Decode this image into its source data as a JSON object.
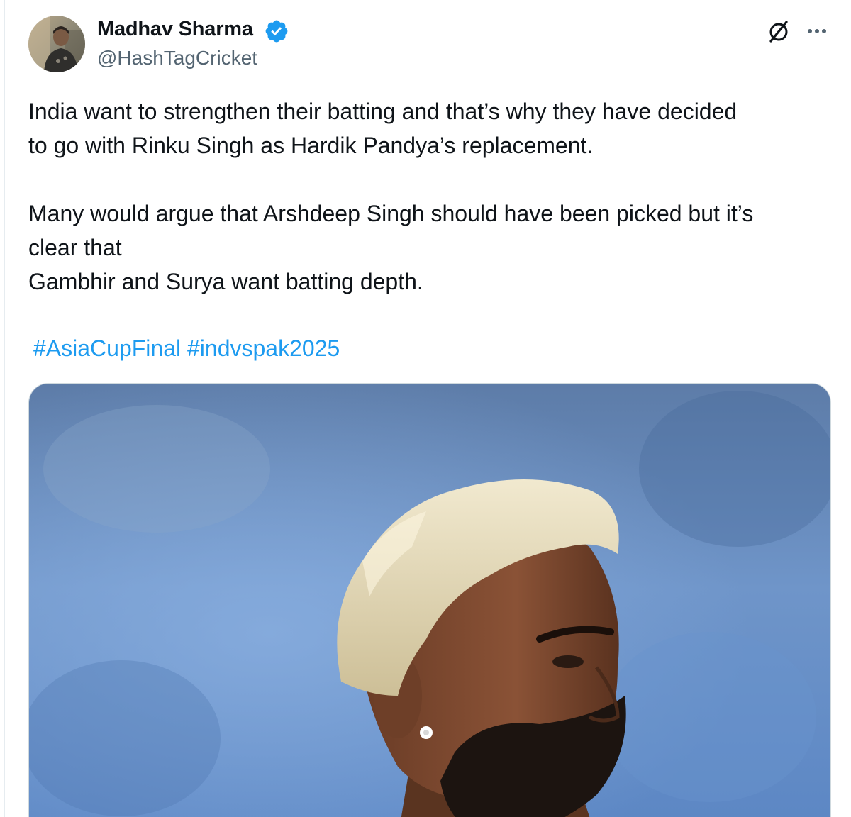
{
  "author": {
    "name": "Madhav Sharma",
    "handle": "@HashTagCricket",
    "verified": true
  },
  "post": {
    "paragraph1": [
      "India want to strengthen their batting and that’s why they have decided",
      "to go with Rinku Singh as Hardik Pandya’s replacement."
    ],
    "paragraph2": [
      "Many would argue that Arshdeep Singh should have been picked but it’s",
      "clear that",
      "Gambhir and Surya want batting depth."
    ],
    "hashtags": [
      "#AsiaCupFinal",
      "#indvspak2025"
    ]
  },
  "icons": {
    "verified": "verified-badge-icon",
    "grok": "grok-icon",
    "more": "more-options-icon"
  },
  "colors": {
    "text": "#0f1419",
    "secondary": "#536471",
    "link": "#1d9bf0",
    "verified": "#1d9bf0"
  }
}
